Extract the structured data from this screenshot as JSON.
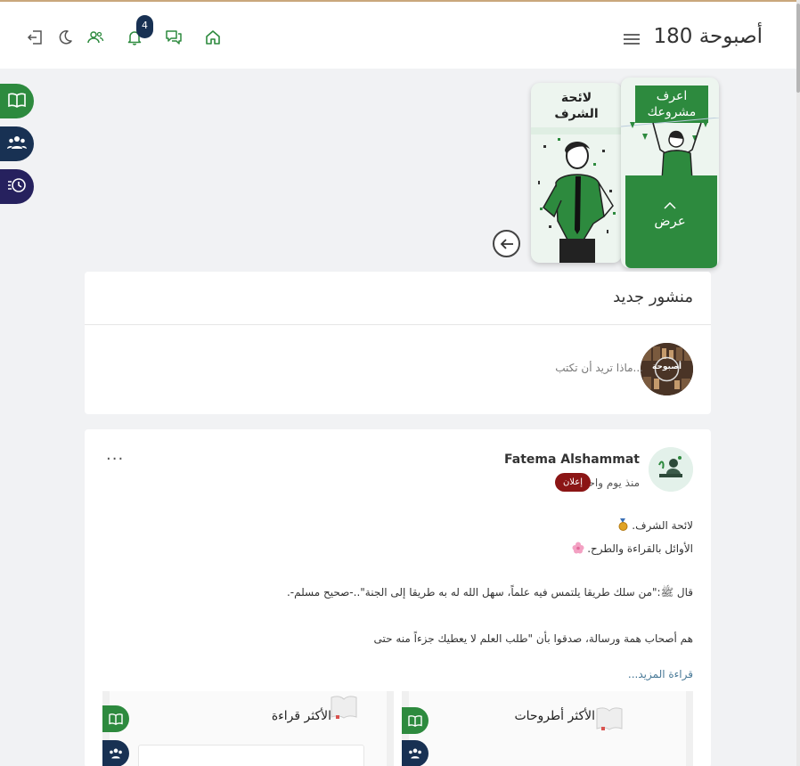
{
  "header": {
    "brand": "أصبوحة 180",
    "notif_count": "4",
    "icons": [
      "home-icon",
      "chat-icon",
      "bell-icon",
      "users-icon",
      "moon-icon",
      "logout-icon"
    ]
  },
  "side_buttons": [
    "book-open-icon",
    "group-icon",
    "history-icon"
  ],
  "stories": {
    "card1_title_line1": "لائحة",
    "card1_title_line2": "الشرف",
    "card2_title_line1": "اعرف",
    "card2_title_line2": "مشروعك",
    "view_label": "عرض"
  },
  "new_post": {
    "title": "منشور جديد",
    "placeholder": "...ماذا تريد أن تكتب",
    "avatar_text": "أصبوحة"
  },
  "post": {
    "author": "Fatema Alshammat",
    "time": "منذ يوم واحد",
    "tag": "إعلان",
    "more": "...",
    "line1": "لائحة الشرف.",
    "line2": "الأوائل بالقراءة والطرح.",
    "line3": "قال ﷺ:\"من سلك طريقا يلتمس فيه علماً، سهل الله له به طريقا إلى الجنة\"..-صحيح مسلم-.",
    "line4": "هم أصحاب همة ورسالة، صدقوا بأن \"طلب العلم لا يعطيك جزءاً منه حتى",
    "read_more": "قراءة المزيد..."
  },
  "thumbs": {
    "left_title": "الأكثر قراءة",
    "right_title": "الأكثر أطروحات"
  },
  "colors": {
    "brand_green": "#2d8a3e",
    "navy": "#183153",
    "indigo": "#26215e",
    "tag_red": "#8b1515"
  }
}
